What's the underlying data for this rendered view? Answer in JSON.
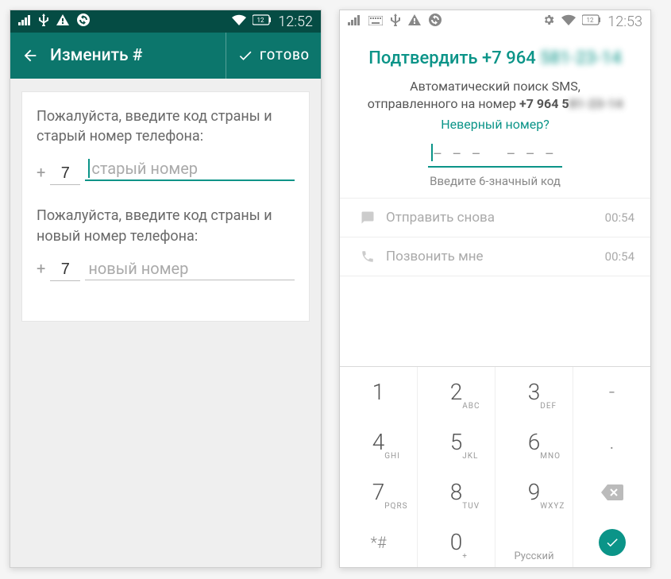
{
  "left": {
    "status": {
      "time": "12:52",
      "battery_lvl": "12"
    },
    "header": {
      "title": "Изменить #",
      "done": "ГОТОВО"
    },
    "form": {
      "prompt_old": "Пожалуйста, введите код страны и старый номер телефона:",
      "cc_old": "7",
      "ph_old": "старый номер",
      "prompt_new": "Пожалуйста, введите код страны и новый номер телефона:",
      "cc_new": "7",
      "ph_new": "новый номер"
    }
  },
  "right": {
    "status": {
      "time": "12:53",
      "battery_lvl": "12"
    },
    "verify": {
      "title_prefix": "Подтвердить +7 964",
      "title_blur": " 581-23-14",
      "info_line1": "Автоматический поиск SMS,",
      "info_line2_a": "отправленного на номер ",
      "info_phone_vis": "+7 964 5",
      "info_phone_blur": "81-23-14",
      "wrong_link": "Неверный номер?",
      "code_hint": "Введите 6-значный код"
    },
    "actions": {
      "resend": "Отправить снова",
      "call": "Позвонить мне",
      "timer": "00:54"
    },
    "keypad": {
      "keys": [
        [
          "1",
          ""
        ],
        [
          "2",
          "ABC"
        ],
        [
          "3",
          "DEF"
        ],
        [
          "4",
          "GHI"
        ],
        [
          "5",
          "JKL"
        ],
        [
          "6",
          "MNO"
        ],
        [
          "7",
          "PQRS"
        ],
        [
          "8",
          "TUV"
        ],
        [
          "9",
          "WXYZ"
        ]
      ],
      "star": "*#",
      "zero": "0",
      "zero_sub": "+",
      "lang": "Русский"
    }
  }
}
